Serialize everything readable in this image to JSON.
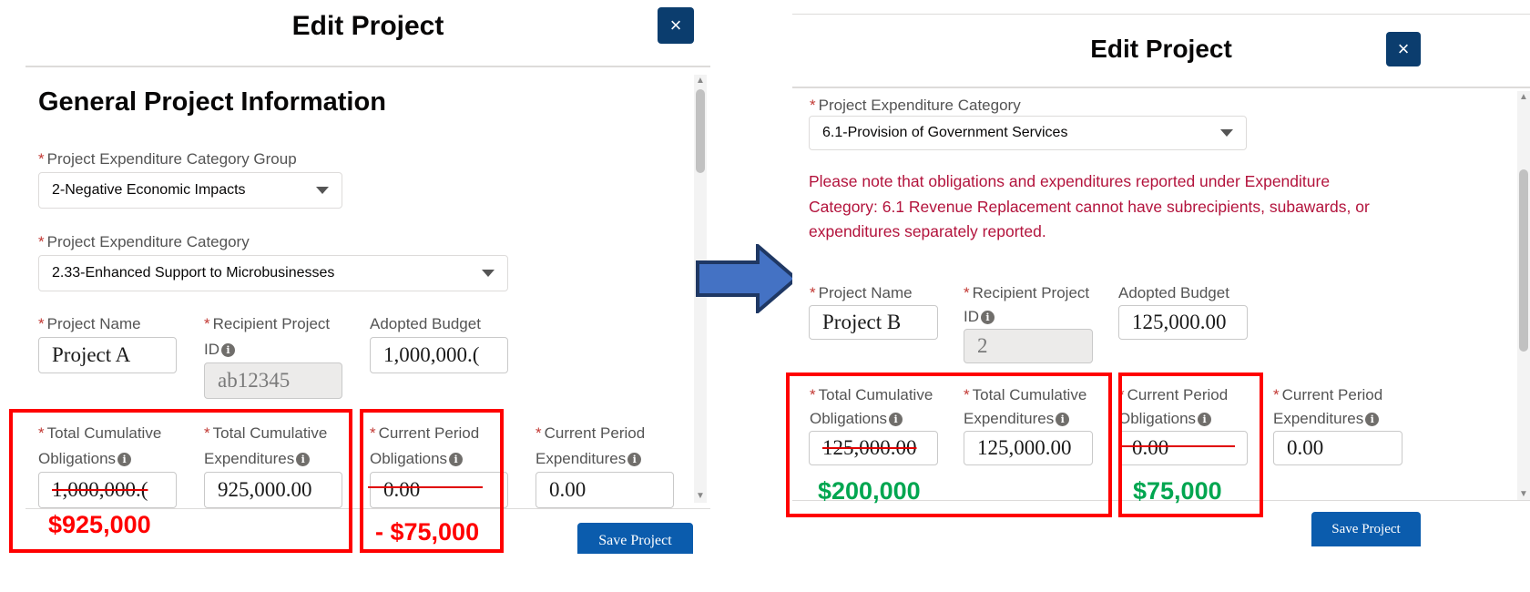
{
  "left": {
    "header": "Edit Project",
    "close_glyph": "×",
    "section_title": "General Project Information",
    "category_group": {
      "label": "Project Expenditure Category Group",
      "value": "2-Negative Economic Impacts"
    },
    "category": {
      "label": "Project Expenditure Category",
      "value": "2.33-Enhanced Support to Microbusinesses"
    },
    "project_name": {
      "label": "Project Name",
      "value": "Project A"
    },
    "recipient_id": {
      "label_line1": "Recipient Project",
      "label_line2": "ID",
      "value": "ab12345"
    },
    "adopted_budget": {
      "label": "Adopted Budget",
      "value": "1,000,000.("
    },
    "total_obligations": {
      "label_line1": "Total Cumulative",
      "label_line2": "Obligations",
      "value": "1,000,000.("
    },
    "total_expenditures": {
      "label_line1": "Total Cumulative",
      "label_line2": "Expenditures",
      "value": "925,000.00"
    },
    "period_obligations": {
      "label_line1": "Current Period",
      "label_line2": "Obligations",
      "value": "0.00"
    },
    "period_expenditures": {
      "label_line1": "Current Period",
      "label_line2": "Expenditures",
      "value": "0.00"
    },
    "save_label": "Save Project",
    "annotation_total": "$925,000",
    "annotation_period": "- $75,000"
  },
  "right": {
    "header": "Edit Project",
    "close_glyph": "×",
    "category": {
      "label": "Project Expenditure Category",
      "value": "6.1-Provision of Government Services"
    },
    "warning_lines": [
      "Please note that obligations and expenditures reported under Expenditure",
      "Category: 6.1 Revenue Replacement cannot have subrecipients, subawards, or",
      "expenditures separately reported."
    ],
    "project_name": {
      "label": "Project Name",
      "value": "Project B"
    },
    "recipient_id": {
      "label_line1": "Recipient Project",
      "label_line2": "ID",
      "value": "2"
    },
    "adopted_budget": {
      "label": "Adopted Budget",
      "value": "125,000.00"
    },
    "total_obligations": {
      "label_line1": "Total Cumulative",
      "label_line2": "Obligations",
      "value": "125,000.00"
    },
    "total_expenditures": {
      "label_line1": "Total Cumulative",
      "label_line2": "Expenditures",
      "value": "125,000.00"
    },
    "period_obligations": {
      "label_line1": "Current Period",
      "label_line2": "Obligations",
      "value": "0.00"
    },
    "period_expenditures": {
      "label_line1": "Current Period",
      "label_line2": "Expenditures",
      "value": "0.00"
    },
    "save_label": "Save Project",
    "annotation_total": "$200,000",
    "annotation_period": "$75,000"
  },
  "info_glyph": "i",
  "colors": {
    "annotation_red": "#ff0000",
    "annotation_green": "#00a650",
    "close_button": "#0b3d6e",
    "save_button": "#0b5cad",
    "warning_text": "#b3133c",
    "arrow_fill": "#4472c4",
    "arrow_outline": "#1f3864"
  },
  "icons": [
    "close-icon",
    "info-icon",
    "dropdown-caret-icon",
    "right-arrow-icon"
  ]
}
